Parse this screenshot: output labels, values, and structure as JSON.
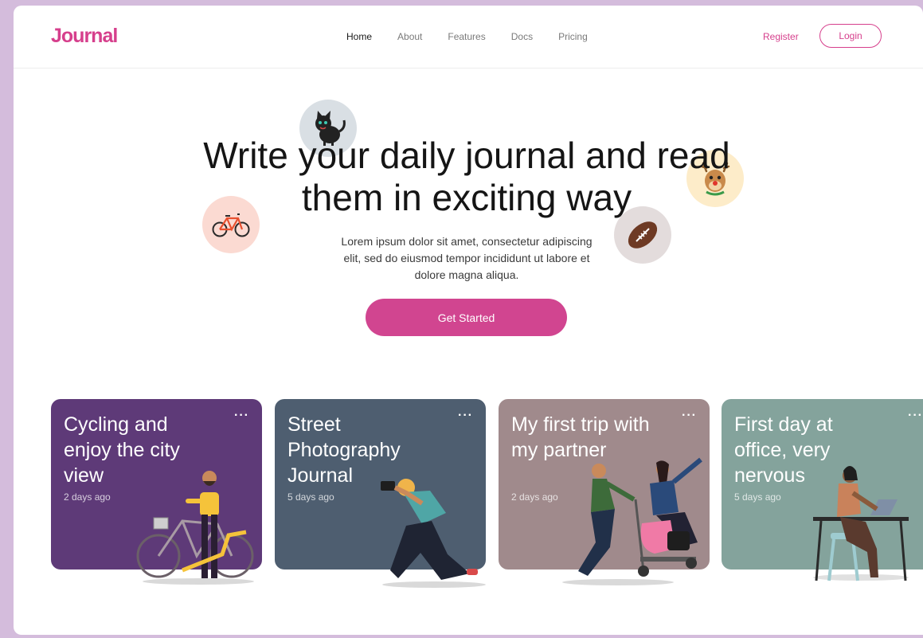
{
  "header": {
    "logo": "Journal",
    "nav": [
      "Home",
      "About",
      "Features",
      "Docs",
      "Pricing"
    ],
    "register_label": "Register",
    "login_label": "Login"
  },
  "hero": {
    "title": "Write your daily journal and read them in exciting way",
    "subtitle": "Lorem ipsum dolor sit amet, consectetur adipiscing elit, sed do eiusmod tempor incididunt ut labore et dolore magna aliqua.",
    "cta_label": "Get Started"
  },
  "icons": [
    "cat-icon",
    "bicycle-icon",
    "reindeer-icon",
    "football-icon"
  ],
  "colors": {
    "brand": "#d63f8c",
    "card_purple": "#5e3a78",
    "card_slate": "#4e5e70",
    "card_mauve": "#a08a8c",
    "card_sage": "#84a39c"
  },
  "cards": [
    {
      "title": "Cycling and enjoy the city view",
      "time": "2 days ago",
      "menu": "···"
    },
    {
      "title": "Street Photography Journal",
      "time": "5 days ago",
      "menu": "···"
    },
    {
      "title": "My first trip with my partner",
      "time": "2 days ago",
      "menu": "···"
    },
    {
      "title": "First day at office, very nervous",
      "time": "5 days ago",
      "menu": "···"
    }
  ]
}
